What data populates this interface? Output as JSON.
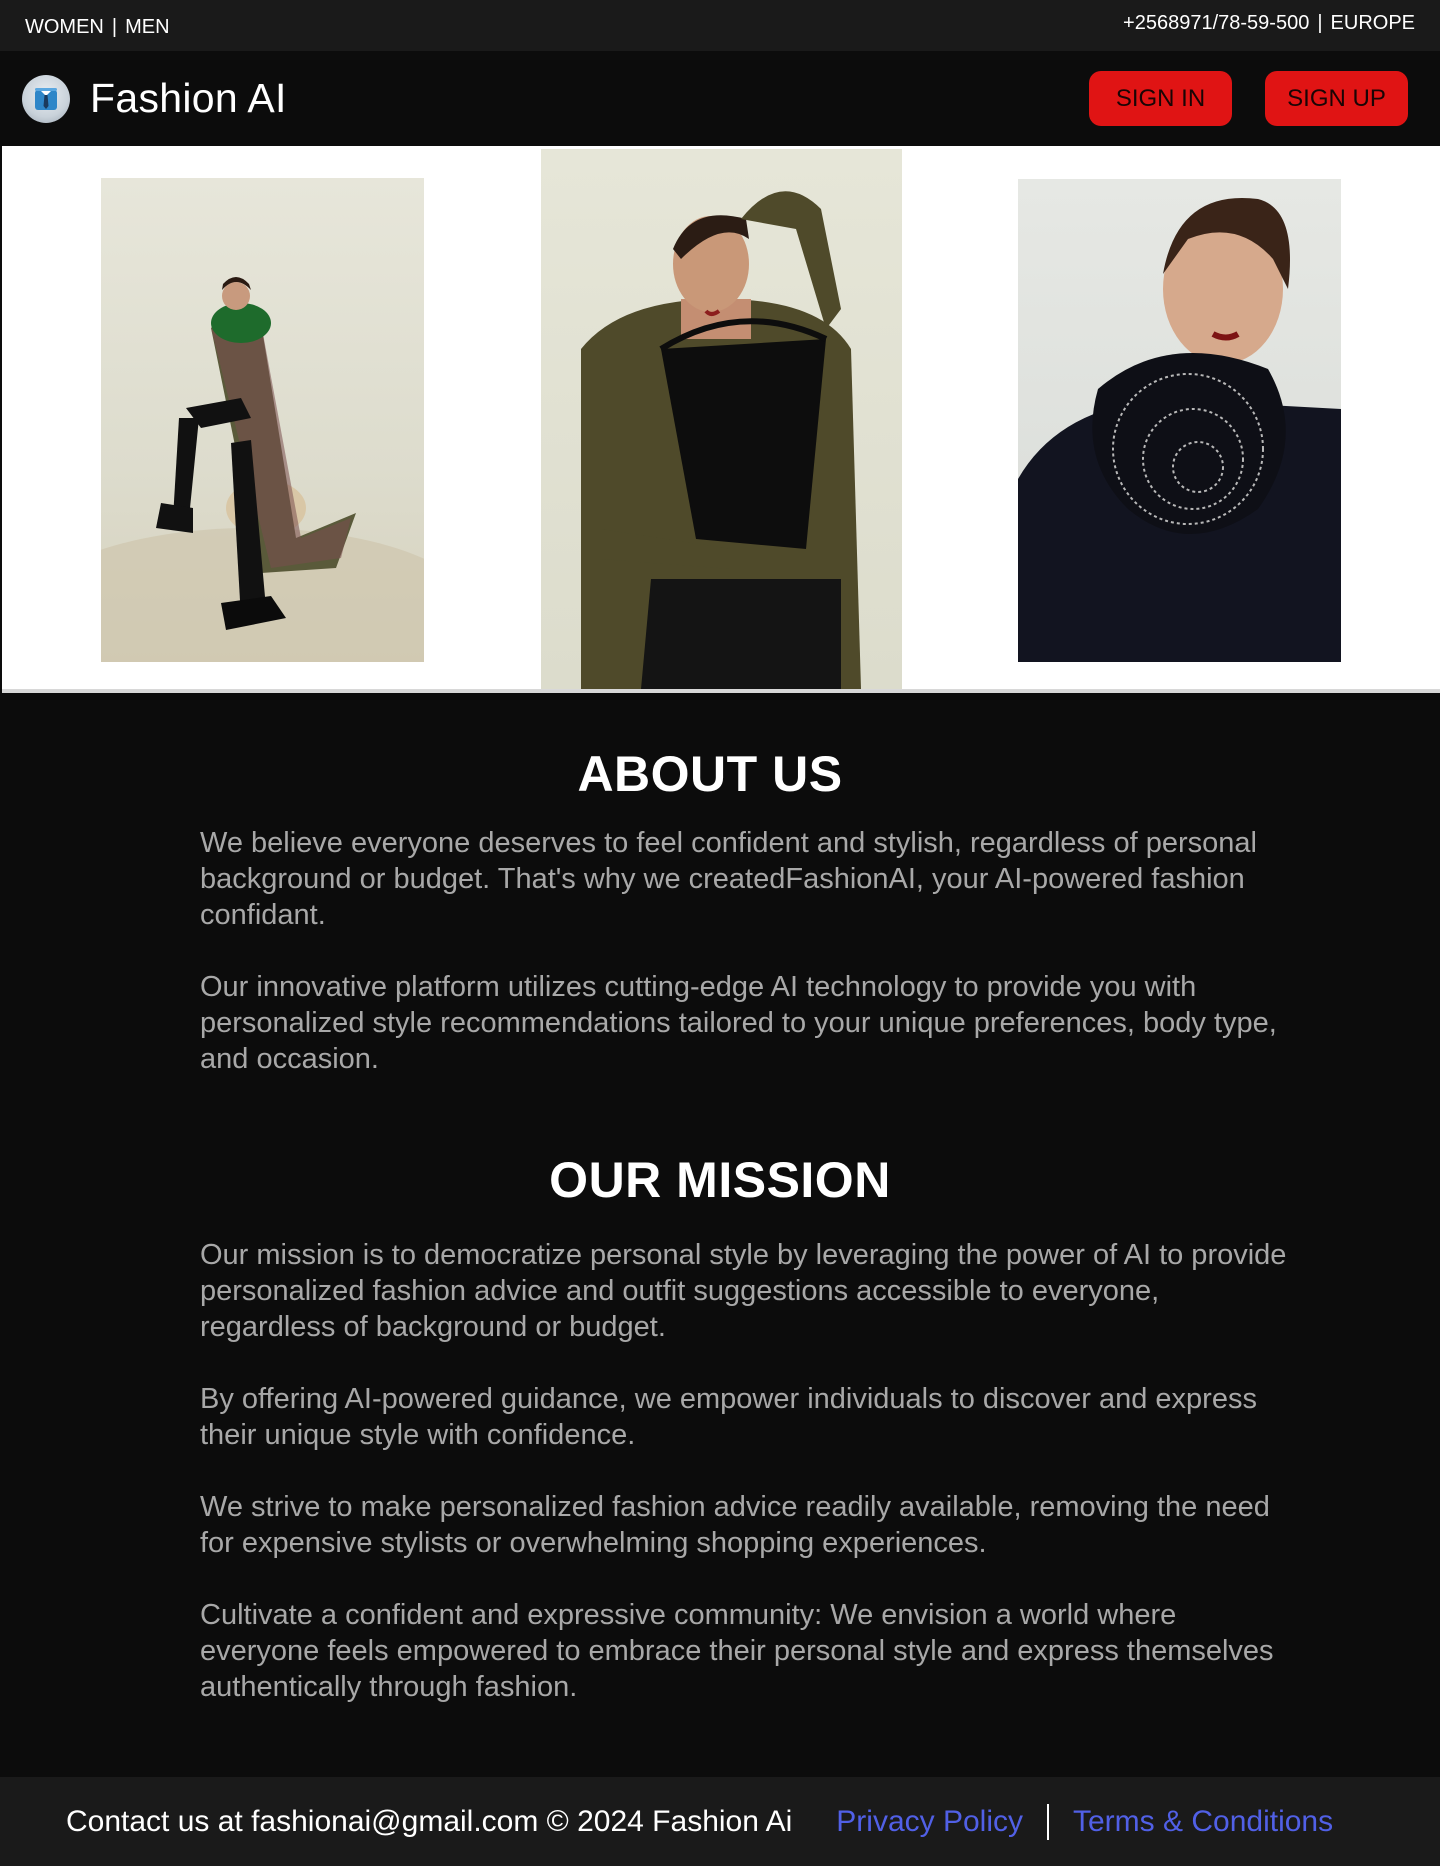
{
  "top_bar": {
    "women_label": "WOMEN",
    "separator": "|",
    "men_label": "MEN",
    "phone": "+2568971/78-59-500",
    "region": "EUROPE"
  },
  "header": {
    "brand_name": "Fashion AI",
    "logo_icon": "shirt-tie-icon",
    "sign_in_label": "SIGN IN",
    "sign_up_label": "SIGN UP"
  },
  "gallery": {
    "images": [
      {
        "alt": "Model seated in plaid coat with green fur collar and black boots"
      },
      {
        "alt": "Model in olive top holding black croc handbag"
      },
      {
        "alt": "Model in black jacket with embellished rosette collar"
      }
    ]
  },
  "about": {
    "title": "ABOUT US",
    "paragraphs": [
      "We believe everyone deserves to feel confident and stylish, regardless of personal background or budget. That's why we createdFashionAI, your AI-powered fashion confidant.",
      "Our innovative platform utilizes cutting-edge AI technology to provide you with personalized style recommendations tailored to your unique preferences, body type, and occasion."
    ]
  },
  "mission": {
    "title": "OUR MISSION",
    "paragraphs": [
      "Our mission is to democratize personal style by leveraging the power of AI to provide personalized fashion advice and outfit suggestions accessible to everyone, regardless of background or budget.",
      "By offering AI-powered guidance, we empower individuals to discover and express their unique style with confidence.",
      "We strive to make personalized fashion advice readily available, removing the need for expensive stylists or overwhelming shopping experiences.",
      "Cultivate a confident and expressive community: We envision a world where everyone feels empowered to embrace their personal style and express themselves authentically through fashion."
    ]
  },
  "footer": {
    "contact_text": "Contact us at fashionai@gmail.com © 2024 Fashion Ai",
    "privacy_label": "Privacy Policy",
    "terms_label": "Terms & Conditions"
  },
  "colors": {
    "background": "#0c0c0c",
    "bar": "#1a1a1a",
    "accent_red": "#e01414",
    "link_blue": "#5160e6",
    "body_text": "#a8a8a8"
  }
}
